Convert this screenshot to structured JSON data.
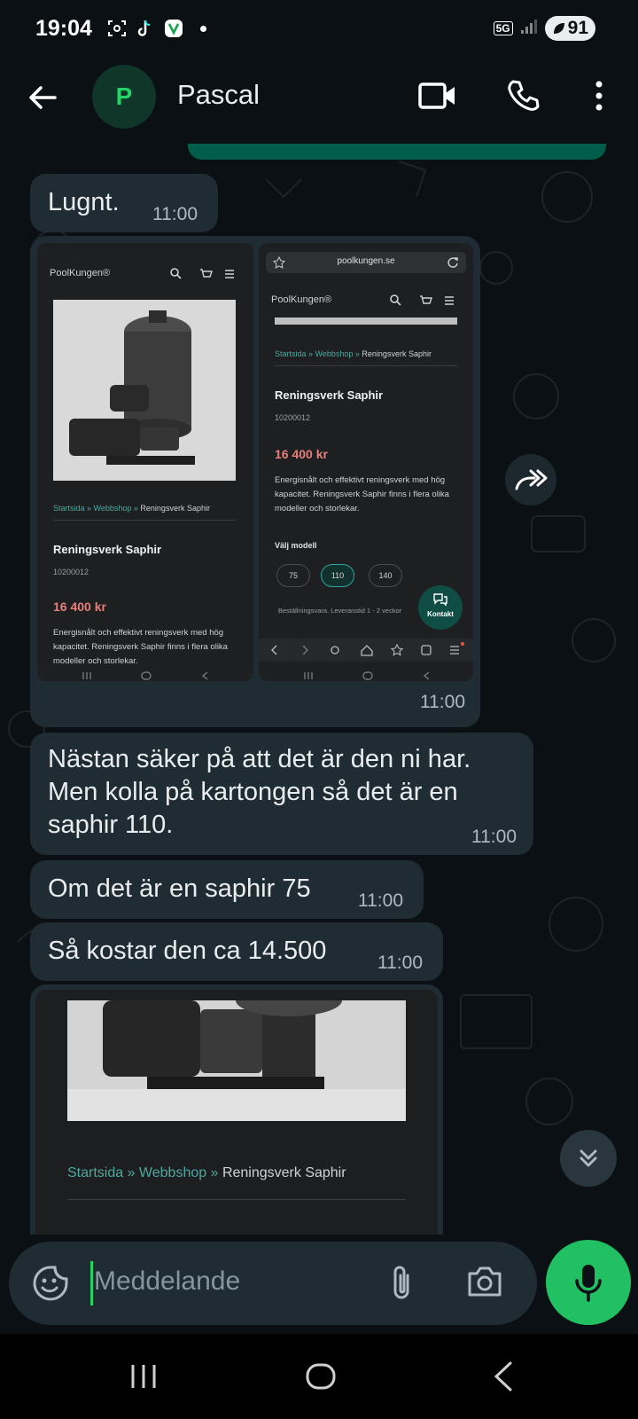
{
  "status_bar": {
    "time": "19:04",
    "network": "5G",
    "battery": "91"
  },
  "header": {
    "avatar_initial": "P",
    "contact_name": "Pascal"
  },
  "messages": [
    {
      "text": "Lugnt.",
      "time": "11:00"
    },
    {
      "image_time": "11:00"
    },
    {
      "text": "Nästan säker på att det är den ni har. Men kolla på kartongen så det är en saphir 110.",
      "time": "11:00"
    },
    {
      "text": "Om det är en saphir 75",
      "time": "11:00"
    },
    {
      "text": "Så kostar den ca 14.500",
      "time": "11:00"
    }
  ],
  "screenshot_left": {
    "logo": "PoolKungen®",
    "breadcrumb_links": "Startsida » Webbshop »",
    "breadcrumb_current": "Reningsverk Saphir",
    "title": "Reningsverk Saphir",
    "sku": "10200012",
    "price": "16 400 kr",
    "description": "Energisnålt och effektivt reningsverk med hög kapacitet. Reningsverk Saphir finns i flera olika modeller och storlekar."
  },
  "screenshot_right": {
    "url": "poolkungen.se",
    "logo": "PoolKungen®",
    "breadcrumb_links": "Startsida » Webbshop »",
    "breadcrumb_current": "Reningsverk Saphir",
    "title": "Reningsverk Saphir",
    "sku": "10200012",
    "price": "16 400 kr",
    "description": "Energisnålt och effektivt reningsverk med hög kapacitet. Reningsverk Saphir finns i flera olika modeller och storlekar.",
    "model_label": "Välj modell",
    "models": [
      "75",
      "110",
      "140"
    ],
    "delivery": "Beställningsvara. Leveranstid 1 - 2 veckor",
    "contact_label": "Kontakt"
  },
  "image_bubble_2": {
    "breadcrumb_links": "Startsida » Webbshop »",
    "breadcrumb_current": "Reningsverk Saphir"
  },
  "input": {
    "placeholder": "Meddelande"
  },
  "colors": {
    "accent": "#25d366",
    "bubble_in": "#202c33",
    "bubble_out": "#005c4b",
    "background": "#0b1014"
  },
  "icons": [
    "back-arrow-icon",
    "video-call-icon",
    "phone-icon",
    "more-vert-icon",
    "forward-icon",
    "double-chevron-down-icon",
    "sticker-icon",
    "attach-icon",
    "camera-icon",
    "mic-icon",
    "recents-icon",
    "home-icon",
    "nav-back-icon"
  ]
}
